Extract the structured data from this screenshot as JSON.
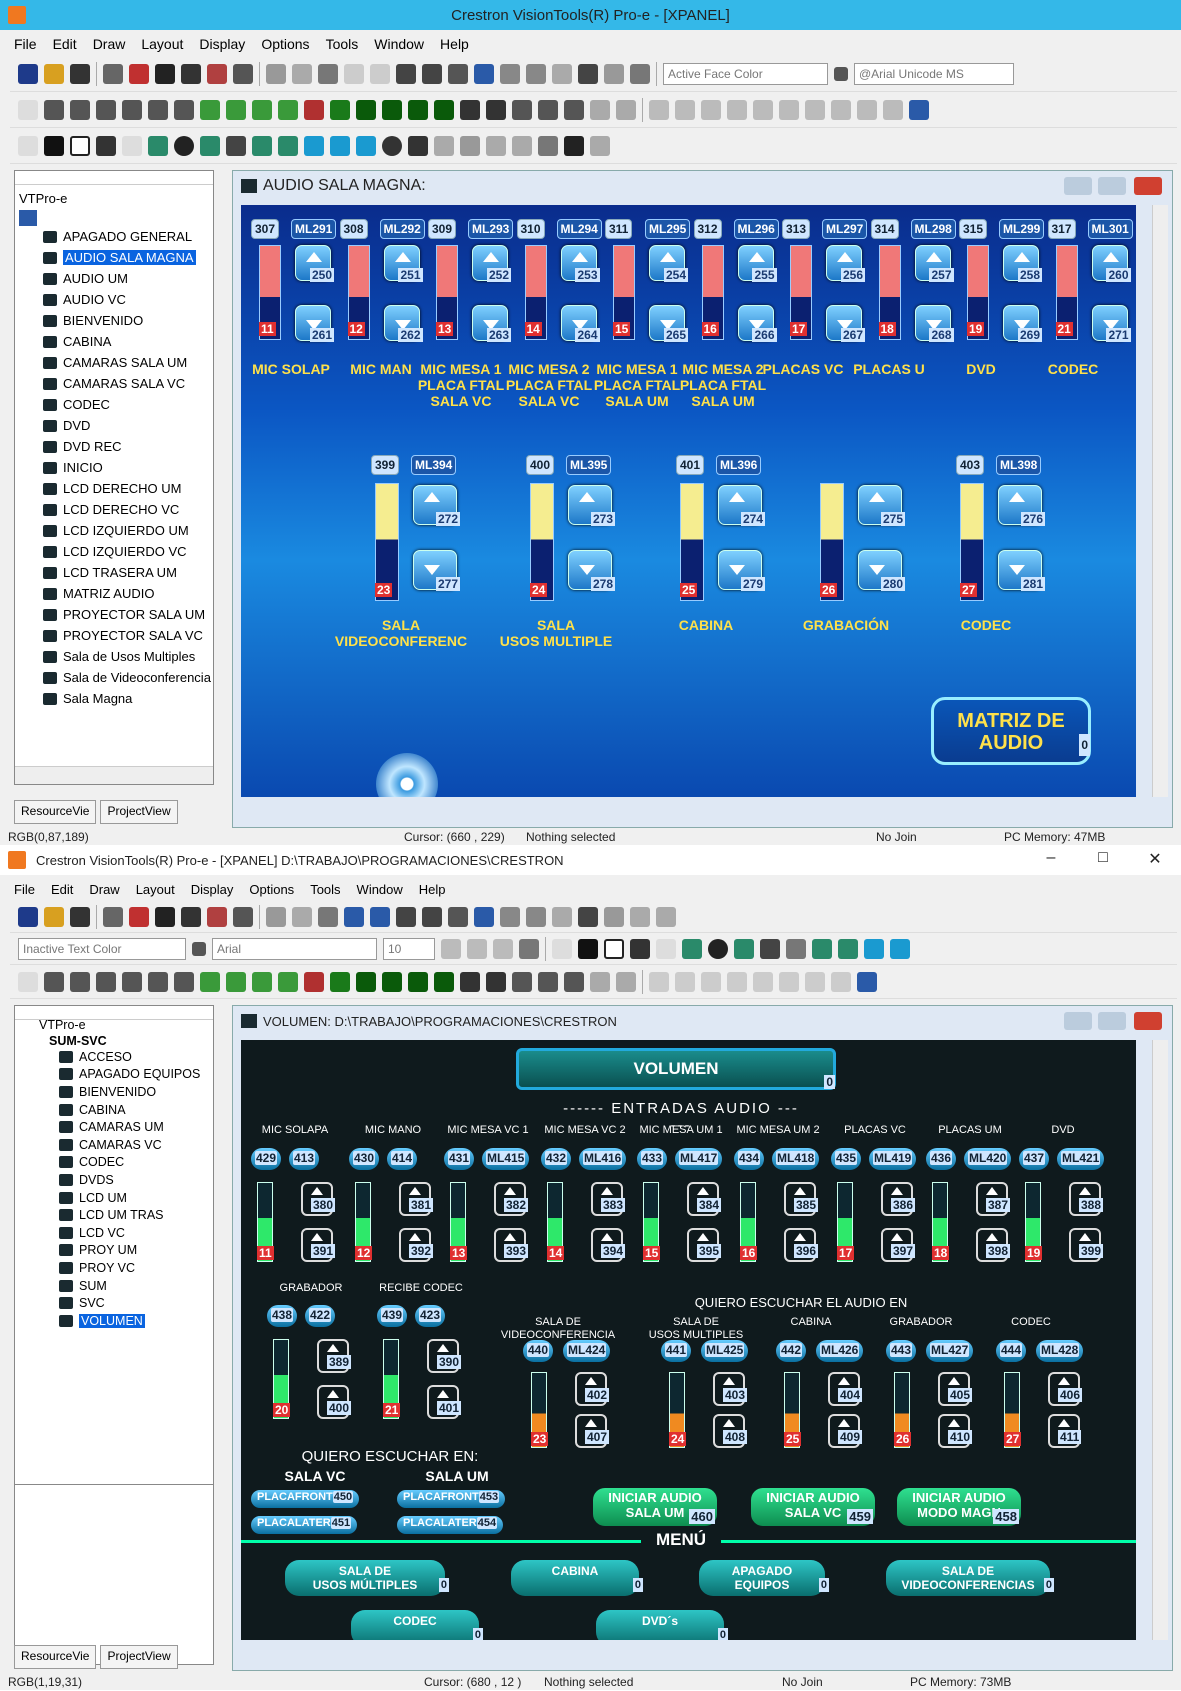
{
  "w1": {
    "title": "Crestron VisionTools(R) Pro-e - [XPANEL]",
    "menus": [
      "File",
      "Edit",
      "Draw",
      "Layout",
      "Display",
      "Options",
      "Tools",
      "Window",
      "Help"
    ],
    "face_color_combo": "Active Face Color",
    "font_combo": "@Arial Unicode MS",
    "tree_root": "VTPro-e",
    "tree_items": [
      "APAGADO GENERAL",
      "AUDIO SALA MAGNA",
      "AUDIO UM",
      "AUDIO VC",
      "BIENVENIDO",
      "CABINA",
      "CAMARAS SALA UM",
      "CAMARAS SALA VC",
      "CODEC",
      "DVD",
      "DVD REC",
      "INICIO",
      "LCD DERECHO UM",
      "LCD DERECHO VC",
      "LCD IZQUIERDO UM",
      "LCD IZQUIERDO VC",
      "LCD TRASERA UM",
      "MATRIZ AUDIO",
      "PROYECTOR SALA UM",
      "PROYECTOR SALA VC",
      "Sala de Usos Multiples",
      "Sala de Videoconferencia",
      "Sala Magna"
    ],
    "tab_resource": "ResourceVie",
    "tab_project": "ProjectView",
    "child_title": "AUDIO SALA MAGNA:",
    "top_channels": [
      {
        "id": "307",
        "mu": "ML291",
        "up": "250",
        "dn": "261",
        "n": "11"
      },
      {
        "id": "308",
        "mu": "ML292",
        "up": "251",
        "dn": "262",
        "n": "12"
      },
      {
        "id": "309",
        "mu": "ML293",
        "up": "252",
        "dn": "263",
        "n": "13"
      },
      {
        "id": "310",
        "mu": "ML294",
        "up": "253",
        "dn": "264",
        "n": "14"
      },
      {
        "id": "311",
        "mu": "ML295",
        "up": "254",
        "dn": "265",
        "n": "15"
      },
      {
        "id": "312",
        "mu": "ML296",
        "up": "255",
        "dn": "266",
        "n": "16"
      },
      {
        "id": "313",
        "mu": "ML297",
        "up": "256",
        "dn": "267",
        "n": "17"
      },
      {
        "id": "314",
        "mu": "ML298",
        "up": "257",
        "dn": "268",
        "n": "18"
      },
      {
        "id": "315",
        "mu": "ML299",
        "up": "258",
        "dn": "269",
        "n": "19"
      },
      {
        "id": "317",
        "mu": "ML301",
        "up": "260",
        "dn": "271",
        "n": "21"
      }
    ],
    "top_labels": [
      "MIC SOLAP",
      "MIC MAN",
      "MIC MESA 1\nPLACA FTAL\nSALA VC",
      "MIC MESA 2\nPLACA FTAL\nSALA VC",
      "MIC MESA 1\nPLACA FTAL\nSALA UM",
      "MIC MESA 2\nPLACA FTAL\nSALA UM",
      "PLACAS VC",
      "PLACAS U",
      "DVD",
      "CODEC"
    ],
    "bottom_channels": [
      {
        "id": "399",
        "mu": "ML394",
        "up": "272",
        "dn": "277",
        "n": "23",
        "label": "SALA\nVIDEOCONFERENC"
      },
      {
        "id": "400",
        "mu": "ML395",
        "up": "273",
        "dn": "278",
        "n": "24",
        "label": "SALA\nUSOS MULTIPLE"
      },
      {
        "id": "401",
        "mu": "ML396",
        "up": "274",
        "dn": "279",
        "n": "25",
        "label": "CABINA"
      },
      {
        "id": "",
        "mu": "",
        "up": "275",
        "dn": "280",
        "n": "26",
        "label": "GRABACIÓN"
      },
      {
        "id": "403",
        "mu": "ML398",
        "up": "276",
        "dn": "281",
        "n": "27",
        "label": "CODEC"
      }
    ],
    "matriz_btn": "MATRIZ DE\nAUDIO",
    "matriz_num": "0",
    "status_rgb": "RGB(0,87,189)",
    "status_cursor": "Cursor: (660 , 229)",
    "status_sel": "Nothing selected",
    "status_join": "No Join",
    "status_mem": "PC Memory: 47MB"
  },
  "w2": {
    "title": "Crestron VisionTools(R) Pro-e - [XPANEL] D:\\TRABAJO\\PROGRAMACIONES\\CRESTRON",
    "menus": [
      "File",
      "Edit",
      "Draw",
      "Layout",
      "Display",
      "Options",
      "Tools",
      "Window",
      "Help"
    ],
    "text_color_combo": "Inactive Text Color",
    "font_combo": "Arial",
    "size_combo": "10",
    "tree_root": "VTPro-e",
    "tree_group": "SUM-SVC",
    "tree_items": [
      "ACCESO",
      "APAGADO EQUIPOS",
      "BIENVENIDO",
      "CABINA",
      "CAMARAS UM",
      "CAMARAS VC",
      "CODEC",
      "DVDS",
      "LCD UM",
      "LCD UM TRAS",
      "LCD VC",
      "PROY UM",
      "PROY VC",
      "SUM",
      "SVC",
      "VOLUMEN"
    ],
    "tab_resource": "ResourceVie",
    "tab_project": "ProjectView",
    "child_title": "VOLUMEN: D:\\TRABAJO\\PROGRAMACIONES\\CRESTRON",
    "header_btn": "VOLUMEN",
    "header_num": "0",
    "entradas": "------ ENTRADAS  AUDIO ------",
    "in_labels": [
      "MIC SOLAPA",
      "MIC MANO",
      "MIC MESA VC 1",
      "MIC MESA VC 2",
      "MIC MESA UM 1",
      "MIC MESA UM 2",
      "PLACAS VC",
      "PLACAS UM",
      "DVD"
    ],
    "in_channels": [
      {
        "id": "429",
        "mu": "413",
        "up": "380",
        "dn": "391",
        "n": "11"
      },
      {
        "id": "430",
        "mu": "414",
        "up": "381",
        "dn": "392",
        "n": "12"
      },
      {
        "id": "431",
        "mu": "ML415",
        "up": "382",
        "dn": "393",
        "n": "13"
      },
      {
        "id": "432",
        "mu": "ML416",
        "up": "383",
        "dn": "394",
        "n": "14"
      },
      {
        "id": "433",
        "mu": "ML417",
        "up": "384",
        "dn": "395",
        "n": "15"
      },
      {
        "id": "434",
        "mu": "ML418",
        "up": "385",
        "dn": "396",
        "n": "16"
      },
      {
        "id": "435",
        "mu": "ML419",
        "up": "386",
        "dn": "397",
        "n": "17"
      },
      {
        "id": "436",
        "mu": "ML420",
        "up": "387",
        "dn": "398",
        "n": "18"
      },
      {
        "id": "437",
        "mu": "ML421",
        "up": "388",
        "dn": "399",
        "n": "19"
      }
    ],
    "grab_labels": [
      "GRABADOR",
      "RECIBE CODEC"
    ],
    "grab_channels": [
      {
        "id": "438",
        "mu": "422",
        "up": "389",
        "dn": "400",
        "n": "20"
      },
      {
        "id": "439",
        "mu": "423",
        "up": "390",
        "dn": "401",
        "n": "21"
      }
    ],
    "quiero_audio": "QUIERO ESCUCHAR EL AUDIO EN",
    "out_labels": [
      "SALA DE\nVIDEOCONFERENCIA",
      "SALA DE\nUSOS MULTIPLES",
      "CABINA",
      "GRABADOR",
      "CODEC"
    ],
    "out_channels": [
      {
        "id": "440",
        "mu": "ML424",
        "up": "402",
        "dn": "407",
        "n": "23"
      },
      {
        "id": "441",
        "mu": "ML425",
        "up": "403",
        "dn": "408",
        "n": "24"
      },
      {
        "id": "442",
        "mu": "ML426",
        "up": "404",
        "dn": "409",
        "n": "25"
      },
      {
        "id": "443",
        "mu": "ML427",
        "up": "405",
        "dn": "410",
        "n": "26"
      },
      {
        "id": "444",
        "mu": "ML428",
        "up": "406",
        "dn": "411",
        "n": "27"
      }
    ],
    "quiero_en": "QUIERO ESCUCHAR EN:",
    "sala_vc": "SALA VC",
    "sala_um": "SALA UM",
    "placas": [
      {
        "label": "PLACAFRONT",
        "num": "450"
      },
      {
        "label": "PLACALATER",
        "num": "451"
      },
      {
        "label": "PLACAFRONT",
        "num": "453"
      },
      {
        "label": "PLACALATER",
        "num": "454"
      }
    ],
    "iniciar": [
      {
        "label": "INICIAR AUDIO\nSALA UM",
        "num": "460"
      },
      {
        "label": "INICIAR AUDIO\nSALA VC",
        "num": "459"
      },
      {
        "label": "INICIAR AUDIO\nMODO MAGN",
        "num": "458"
      }
    ],
    "menu_title": "MENÚ",
    "menu_btns": [
      {
        "label": "SALA DE\nUSOS MÚLTIPLES",
        "num": "0"
      },
      {
        "label": "CABINA",
        "num": "0"
      },
      {
        "label": "APAGADO\nEQUIPOS",
        "num": "0"
      },
      {
        "label": "SALA DE\nVIDEOCONFERENCIAS",
        "num": "0"
      },
      {
        "label": "CODEC",
        "num": "0"
      },
      {
        "label": "DVD´s",
        "num": "0"
      }
    ],
    "status_rgb": "RGB(1,19,31)",
    "status_cursor": "Cursor: (680 , 12 )",
    "status_sel": "Nothing selected",
    "status_join": "No Join",
    "status_mem": "PC Memory: 73MB"
  }
}
